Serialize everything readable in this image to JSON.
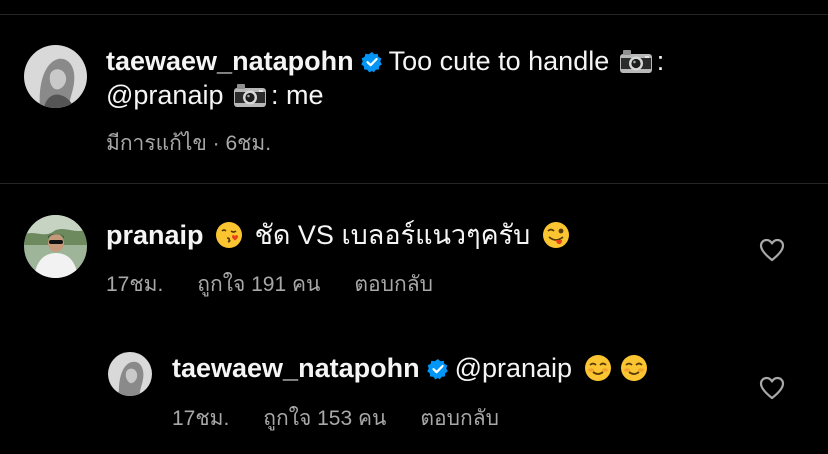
{
  "caption": {
    "username": "taewaew_natapohn",
    "text_part1": "Too cute to handle",
    "text_sep1": ":",
    "mention": "@pranaip",
    "text_sep2": ": me",
    "meta": "มีการแก้ไข · 6ชม."
  },
  "comment": {
    "username": "pranaip",
    "text": "ชัด VS เบลอร์แนวๆครับ",
    "time": "17ชม.",
    "likes": "ถูกใจ 191 คน",
    "reply_label": "ตอบกลับ"
  },
  "reply": {
    "username": "taewaew_natapohn",
    "text": "@pranaip",
    "time": "17ชม.",
    "likes": "ถูกใจ 153 คน",
    "reply_label": "ตอบกลับ"
  },
  "icons": {
    "verified": "verified-badge-icon",
    "camera": "camera-emoji",
    "heart": "heart-outline-icon",
    "kiss": "kissing-face-emoji",
    "wink_tongue": "winking-tongue-emoji",
    "smiling": "smiling-face-emoji"
  },
  "colors": {
    "background": "#000000",
    "text": "#f5f5f5",
    "secondary": "#a8a8a8",
    "verified": "#0095f6"
  }
}
